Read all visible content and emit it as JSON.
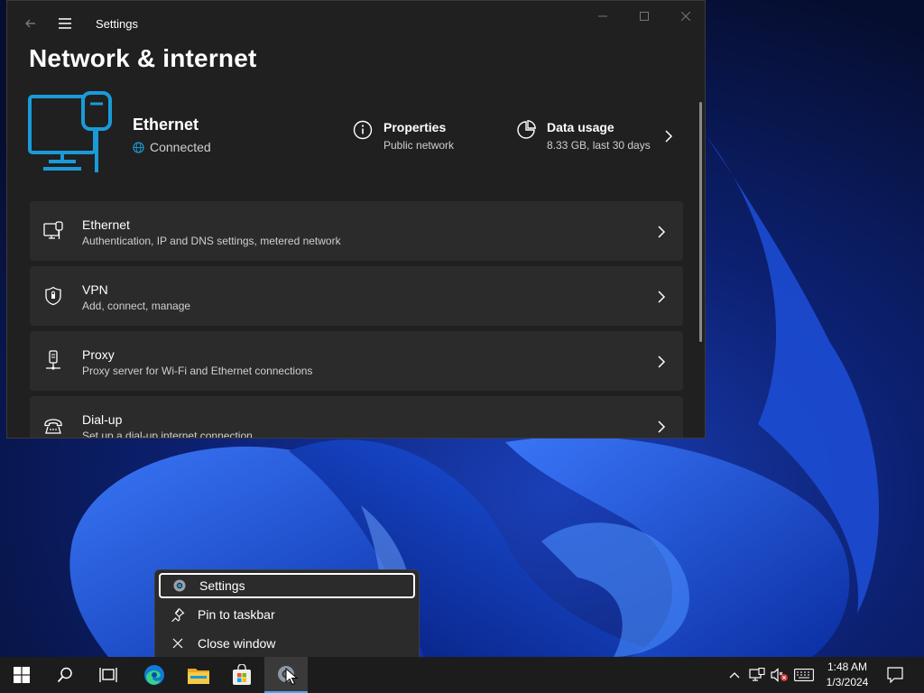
{
  "window": {
    "app_title": "Settings",
    "page_title": "Network & internet"
  },
  "hero": {
    "name": "Ethernet",
    "status": "Connected",
    "properties": {
      "title": "Properties",
      "subtitle": "Public network"
    },
    "data_usage": {
      "title": "Data usage",
      "subtitle": "8.33 GB, last 30 days"
    }
  },
  "settings_rows": [
    {
      "title": "Ethernet",
      "subtitle": "Authentication, IP and DNS settings, metered network",
      "icon": "ethernet-icon"
    },
    {
      "title": "VPN",
      "subtitle": "Add, connect, manage",
      "icon": "shield-icon"
    },
    {
      "title": "Proxy",
      "subtitle": "Proxy server for Wi-Fi and Ethernet connections",
      "icon": "proxy-icon"
    },
    {
      "title": "Dial-up",
      "subtitle": "Set up a dial-up internet connection",
      "icon": "dialup-icon"
    }
  ],
  "context_menu": {
    "items": [
      {
        "label": "Settings",
        "icon": "gear-icon"
      },
      {
        "label": "Pin to taskbar",
        "icon": "pin-icon"
      },
      {
        "label": "Close window",
        "icon": "close-icon"
      }
    ]
  },
  "taskbar": {
    "apps": [
      "start-icon",
      "search-icon",
      "task-view-icon",
      "edge-icon",
      "file-explorer-icon",
      "store-icon",
      "settings-icon"
    ],
    "clock": {
      "time": "1:48 AM",
      "date": "1/3/2024"
    }
  },
  "colors": {
    "accent": "#1a9bd8",
    "window_bg": "#202020",
    "row_bg": "#2b2b2b",
    "taskbar_bg": "#1c1c1c"
  }
}
